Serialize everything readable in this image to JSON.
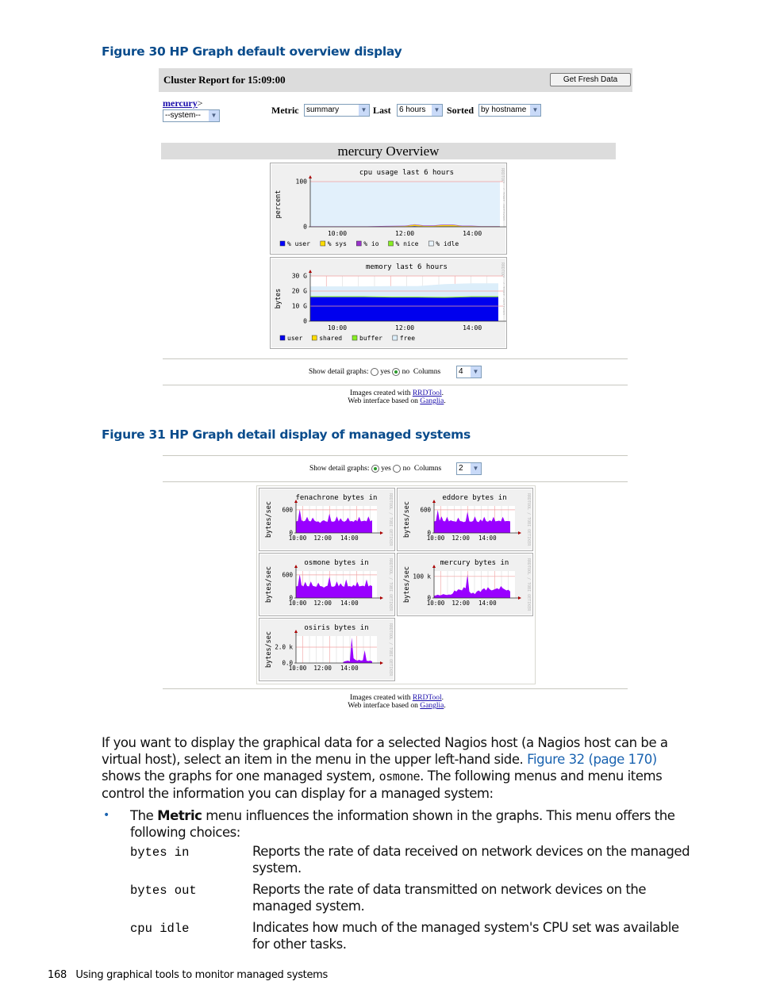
{
  "figure30": {
    "caption": "Figure 30 HP Graph default overview display",
    "header": {
      "title": "Cluster Report for 15:09:00",
      "refresh_button": "Get Fresh Data"
    },
    "host_link": "mercury",
    "host_sep": ">",
    "system_select": "--system--",
    "metric_label": "Metric",
    "metric_value": "summary",
    "last_label": "Last",
    "last_value": "6 hours",
    "sorted_label": "Sorted",
    "sorted_value": "by hostname",
    "overview_title": "mercury Overview",
    "detail_label": "Show detail graphs:",
    "detail_yes": "yes",
    "detail_no": "no",
    "detail_selected": "no",
    "columns_label": "Columns",
    "columns_value": "4",
    "credits_line1_prefix": "Images created with ",
    "credits_line1_link": "RRDTool",
    "credits_line1_suffix": ".",
    "credits_line2_prefix": "Web interface based on ",
    "credits_line2_link": "Ganglia",
    "credits_line2_suffix": "."
  },
  "figure31": {
    "caption": "Figure 31 HP Graph detail display of managed systems",
    "detail_label": "Show detail graphs:",
    "detail_yes": "yes",
    "detail_no": "no",
    "detail_selected": "yes",
    "columns_label": "Columns",
    "columns_value": "2",
    "credits_line1_prefix": "Images created with ",
    "credits_line1_link": "RRDTool",
    "credits_line1_suffix": ".",
    "credits_line2_prefix": "Web interface based on ",
    "credits_line2_link": "Ganglia",
    "credits_line2_suffix": "."
  },
  "rrd_watermark": "RRDTOOL / TOBI OETIKER",
  "chart_data": [
    {
      "id": "cpu",
      "type": "area",
      "title": "cpu usage last 6 hours",
      "ylabel": "percent",
      "ylim": [
        0,
        100
      ],
      "yticks": [
        "0",
        "100"
      ],
      "xticks": [
        "10:00",
        "12:00",
        "14:00"
      ],
      "legend": [
        {
          "name": "% user",
          "color": "#0000ff"
        },
        {
          "name": "% sys",
          "color": "#ffdd00"
        },
        {
          "name": "% io",
          "color": "#9933cc"
        },
        {
          "name": "% nice",
          "color": "#88ee22"
        },
        {
          "name": "% idle",
          "color": "#eaf4fc"
        }
      ],
      "x": [
        0,
        0.1,
        0.2,
        0.3,
        0.4,
        0.5,
        0.55,
        0.6,
        0.65,
        0.7,
        0.75,
        0.8,
        0.85,
        0.9,
        1.0
      ],
      "series": [
        {
          "name": "% user",
          "values": [
            0,
            0,
            0,
            0,
            0.5,
            0.5,
            1.5,
            0.5,
            0.5,
            1,
            1,
            0.5,
            0.5,
            0.5,
            0.5
          ]
        },
        {
          "name": "% sys",
          "values": [
            0.5,
            0.5,
            0.5,
            0.5,
            0.5,
            1,
            3,
            1.5,
            1.5,
            3,
            3,
            1,
            1,
            0.5,
            0.5
          ]
        },
        {
          "name": "% io",
          "values": [
            0.5,
            0.5,
            0.5,
            0.5,
            1,
            1,
            1,
            1,
            1,
            1,
            1,
            1,
            1,
            0.5,
            0.5
          ]
        }
      ]
    },
    {
      "id": "memory",
      "type": "area",
      "title": "memory last 6 hours",
      "ylabel": "bytes",
      "ylim": [
        0,
        30
      ],
      "yticks": [
        "0",
        "10 G",
        "20 G",
        "30 G"
      ],
      "xticks": [
        "10:00",
        "12:00",
        "14:00"
      ],
      "legend": [
        {
          "name": "user",
          "color": "#0000ee"
        },
        {
          "name": "shared",
          "color": "#ffdd00"
        },
        {
          "name": "buffer",
          "color": "#88ee22"
        },
        {
          "name": "free",
          "color": "#dceefa"
        }
      ],
      "series": [
        {
          "name": "user (GB)",
          "values": [
            16,
            16,
            16,
            15.7,
            15.7,
            15.5,
            16,
            16
          ]
        },
        {
          "name": "buffer (GB)",
          "values": [
            0.6,
            0.6,
            0.6,
            0.6,
            0.6,
            0.6,
            0.6,
            0.6
          ]
        },
        {
          "name": "free (GB)",
          "values": [
            6.5,
            6.5,
            6.5,
            7,
            7,
            8.5,
            8.5,
            8.5
          ]
        }
      ]
    },
    {
      "id": "fenachrone",
      "type": "area",
      "title": "fenachrone bytes in",
      "ylabel": "bytes/sec",
      "ylim": [
        0,
        700
      ],
      "yticks": [
        "0",
        "600"
      ],
      "xticks": [
        "10:00",
        "12:00",
        "14:00"
      ],
      "series": [
        {
          "name": "bytes in",
          "values": [
            300,
            310,
            620,
            330,
            300,
            320,
            420,
            310,
            300,
            400,
            320,
            290,
            300,
            260,
            310,
            330,
            300,
            290,
            500,
            300,
            290,
            310,
            430,
            300,
            380,
            310,
            290,
            320,
            400,
            300,
            310,
            290,
            340,
            300,
            420,
            300,
            310,
            320,
            300,
            430,
            300,
            330
          ]
        }
      ]
    },
    {
      "id": "eddore",
      "type": "area",
      "title": "eddore bytes in",
      "ylabel": "bytes/sec",
      "ylim": [
        0,
        700
      ],
      "yticks": [
        "0",
        "600"
      ],
      "xticks": [
        "10:00",
        "12:00",
        "14:00"
      ],
      "series": [
        {
          "name": "bytes in",
          "values": [
            300,
            310,
            600,
            320,
            430,
            310,
            300,
            420,
            300,
            330,
            310,
            300,
            290,
            400,
            310,
            300,
            280,
            300,
            550,
            300,
            290,
            310,
            430,
            300,
            280,
            350,
            300,
            420,
            310,
            290,
            330,
            300,
            420,
            300,
            310,
            320,
            300,
            420,
            300,
            310,
            310,
            300
          ]
        }
      ]
    },
    {
      "id": "osmone",
      "type": "area",
      "title": "osmone bytes in",
      "ylabel": "bytes/sec",
      "ylim": [
        0,
        700
      ],
      "yticks": [
        "0",
        "600"
      ],
      "xticks": [
        "10:00",
        "12:00",
        "14:00"
      ],
      "series": [
        {
          "name": "bytes in",
          "values": [
            300,
            310,
            620,
            330,
            300,
            420,
            310,
            300,
            430,
            320,
            300,
            290,
            400,
            310,
            300,
            270,
            300,
            320,
            550,
            300,
            290,
            310,
            430,
            300,
            380,
            310,
            290,
            480,
            300,
            310,
            290,
            340,
            300,
            420,
            300,
            310,
            320,
            300,
            480,
            300,
            330,
            310
          ]
        }
      ]
    },
    {
      "id": "mercury",
      "type": "area",
      "title": "mercury bytes in",
      "ylabel": "bytes/sec",
      "ylim": [
        0,
        125
      ],
      "yticks": [
        "0",
        "100 k"
      ],
      "xticks": [
        "10:00",
        "12:00",
        "14:00"
      ],
      "series": [
        {
          "name": "bytes in (k)",
          "values": [
            10,
            12,
            15,
            12,
            14,
            18,
            15,
            14,
            16,
            15,
            20,
            35,
            30,
            40,
            38,
            35,
            50,
            45,
            110,
            30,
            20,
            25,
            18,
            30,
            35,
            28,
            40,
            45,
            35,
            50,
            40,
            35,
            38,
            42,
            45,
            40,
            55,
            45,
            40,
            35,
            38,
            30
          ]
        }
      ]
    },
    {
      "id": "osiris",
      "type": "area",
      "title": "osiris bytes in",
      "ylabel": "bytes/sec",
      "ylim": [
        0,
        3.4
      ],
      "yticks": [
        "0.0",
        "2.0 k"
      ],
      "xticks": [
        "10:00",
        "12:00",
        "14:00"
      ],
      "series": [
        {
          "name": "bytes in (k)",
          "values": [
            0,
            0,
            0,
            0,
            0,
            0,
            0,
            0,
            0,
            0,
            0,
            0,
            0,
            0,
            0,
            0,
            0,
            0,
            0,
            0,
            0,
            0,
            0,
            0,
            0,
            0,
            0.2,
            0.25,
            0.3,
            0.2,
            3.2,
            0.6,
            0.4,
            0.3,
            0.4,
            0.3,
            0.35,
            1.6,
            0.3,
            0.25,
            0.3,
            0.2
          ]
        }
      ]
    }
  ],
  "body": {
    "para1_a": "If you want to display the graphical data for a selected Nagios host (a Nagios host can be a virtual host), select an item in the menu in the upper left-hand side. ",
    "para1_link": "Figure 32 (page 170)",
    "para1_b": " shows the graphs for one managed system, ",
    "para1_code": "osmone",
    "para1_c": ". The following menus and menu items control the information you can display for a managed system:",
    "bullet_a": "The ",
    "bullet_bold": "Metric",
    "bullet_b": " menu influences the information shown in the graphs. This menu offers the following choices:",
    "definitions": [
      {
        "term": "bytes in",
        "desc": "Reports the rate of data received on network devices on the managed system."
      },
      {
        "term": "bytes out",
        "desc": "Reports the rate of data transmitted on network devices on the managed system."
      },
      {
        "term": "cpu idle",
        "desc": "Indicates how much of the managed system's CPU set was available for other tasks."
      }
    ]
  },
  "footer": {
    "page_number": "168",
    "section_title": "Using graphical tools to monitor managed systems"
  }
}
